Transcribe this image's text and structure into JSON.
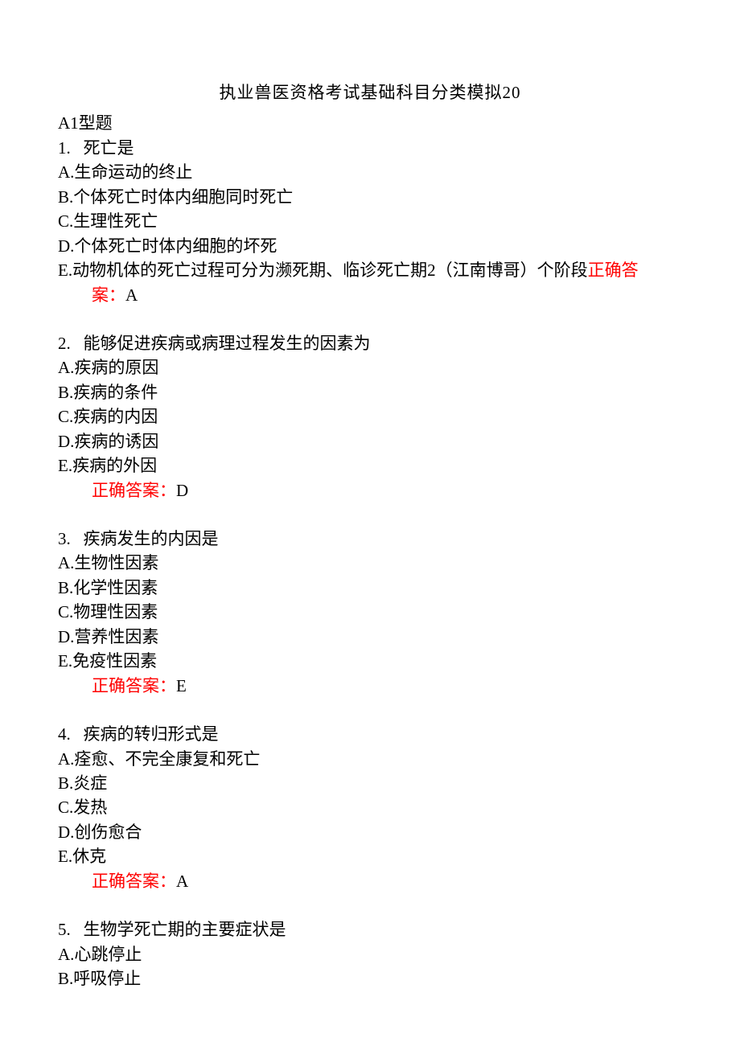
{
  "title": "执业兽医资格考试基础科目分类模拟20",
  "section_header": "A1型题",
  "answer_label": "正确答案：",
  "answer_label_inline": "正确答",
  "answer_label_wrap": "案：",
  "questions": [
    {
      "num": "1.",
      "stem": "死亡是",
      "options": {
        "A": "A.生命运动的终止",
        "B": "B.个体死亡时体内细胞同时死亡",
        "C": "C.生理性死亡",
        "D": "D.个体死亡时体内细胞的坏死",
        "E": "E.动物机体的死亡过程可分为濒死期、临诊死亡期2（江南博哥）个阶段"
      },
      "answer": "A"
    },
    {
      "num": "2.",
      "stem": "能够促进疾病或病理过程发生的因素为",
      "options": {
        "A": "A.疾病的原因",
        "B": "B.疾病的条件",
        "C": "C.疾病的内因",
        "D": "D.疾病的诱因",
        "E": "E.疾病的外因"
      },
      "answer": "D"
    },
    {
      "num": "3.",
      "stem": "疾病发生的内因是",
      "options": {
        "A": "A.生物性因素",
        "B": "B.化学性因素",
        "C": "C.物理性因素",
        "D": "D.营养性因素",
        "E": "E.免疫性因素"
      },
      "answer": "E"
    },
    {
      "num": "4.",
      "stem": "疾病的转归形式是",
      "options": {
        "A": "A.痊愈、不完全康复和死亡",
        "B": "B.炎症",
        "C": "C.发热",
        "D": "D.创伤愈合",
        "E": "E.休克"
      },
      "answer": "A"
    },
    {
      "num": "5.",
      "stem": "生物学死亡期的主要症状是",
      "options": {
        "A": "A.心跳停止",
        "B": "B.呼吸停止"
      },
      "answer": ""
    }
  ]
}
